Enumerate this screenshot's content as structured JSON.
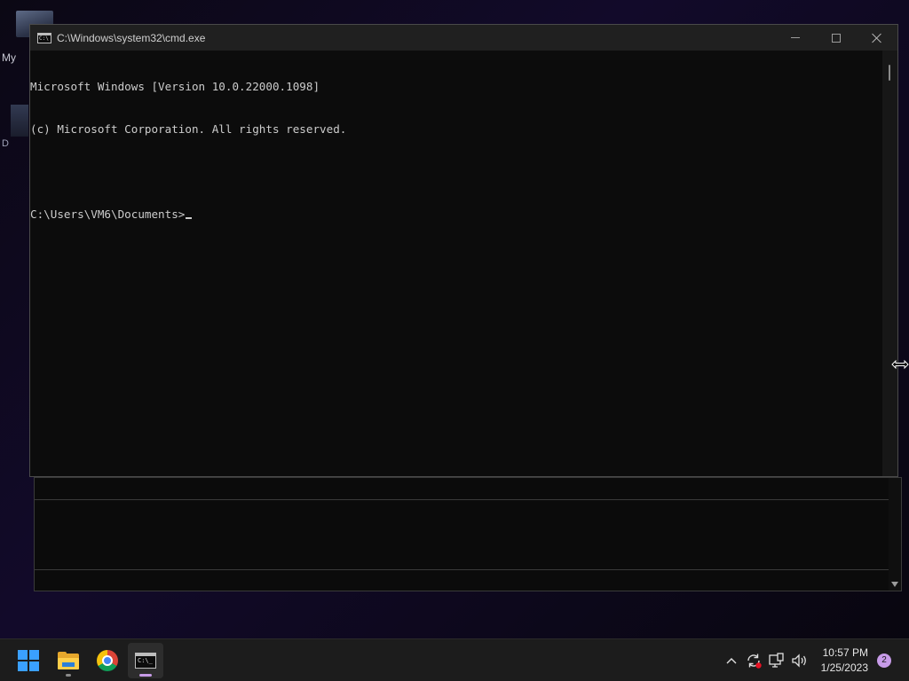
{
  "desktop": {
    "label1_fragment": "My",
    "label2_fragment": "D"
  },
  "cmd_window": {
    "title": "C:\\Windows\\system32\\cmd.exe",
    "console_lines": [
      "Microsoft Windows [Version 10.0.22000.1098]",
      "(c) Microsoft Corporation. All rights reserved.",
      "",
      "C:\\Users\\VM6\\Documents>"
    ],
    "icons": {
      "app": "cmd-icon",
      "minimize": "minimize-icon",
      "maximize": "maximize-icon",
      "close": "close-icon"
    }
  },
  "taskbar": {
    "apps": [
      {
        "name": "Start",
        "icon": "windows-start-icon"
      },
      {
        "name": "File Explorer",
        "icon": "folder-icon"
      },
      {
        "name": "Google Chrome",
        "icon": "chrome-icon"
      },
      {
        "name": "Command Prompt",
        "icon": "cmd-icon",
        "active": true
      }
    ],
    "tray": {
      "time": "10:57 PM",
      "date": "1/25/2023",
      "notification_count": "2",
      "icons": [
        "chevron-up-icon",
        "sync-icon",
        "network-icon",
        "volume-icon"
      ]
    }
  },
  "colors": {
    "accent": "#3aa0ff",
    "console_bg": "#0c0c0c",
    "console_text": "#cccccc",
    "taskbar_bg": "#1c1c1c",
    "badge": "#c79be8"
  }
}
